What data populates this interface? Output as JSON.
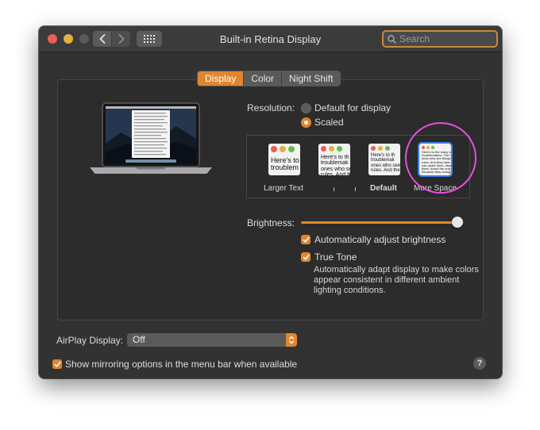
{
  "window": {
    "title": "Built-in Retina Display"
  },
  "search": {
    "placeholder": "Search"
  },
  "tabs": [
    {
      "label": "Display",
      "active": true
    },
    {
      "label": "Color",
      "active": false
    },
    {
      "label": "Night Shift",
      "active": false
    }
  ],
  "resolution": {
    "label": "Resolution:",
    "options": [
      {
        "label": "Default for display",
        "selected": false
      },
      {
        "label": "Scaled",
        "selected": true
      }
    ]
  },
  "scale_options": [
    {
      "label": "Larger Text",
      "preview_text": "Here's to\ntroublem",
      "selected": false
    },
    {
      "label": "",
      "preview_text": "Here's to th\ntroublemak\nones who se\nrules. And th",
      "selected": false
    },
    {
      "label": "Default",
      "preview_text": "Here's to th\ntroublemak\nones who see\nrules. And they",
      "selected": false
    },
    {
      "label": "More Space",
      "preview_text": "Here's to the crazy one\ntroublemakers. The ro\nones who see things di\nrules. And they have no\ncan quote them, disagr\nthem. About the only th\nBecause they change",
      "selected": true
    }
  ],
  "brightness": {
    "label": "Brightness:",
    "value": 0.96,
    "auto_adjust": {
      "label": "Automatically adjust brightness",
      "checked": true
    },
    "true_tone": {
      "label": "True Tone",
      "checked": true,
      "description": "Automatically adapt display to make colors appear consistent in different ambient lighting conditions."
    }
  },
  "airplay": {
    "label": "AirPlay Display:",
    "value": "Off"
  },
  "mirroring": {
    "label": "Show mirroring options in the menu bar when available",
    "checked": true
  },
  "help": {
    "label": "?"
  },
  "colors": {
    "accent": "#e0862f",
    "annotation": "#e44fe0",
    "selection": "#3d7ee8"
  }
}
